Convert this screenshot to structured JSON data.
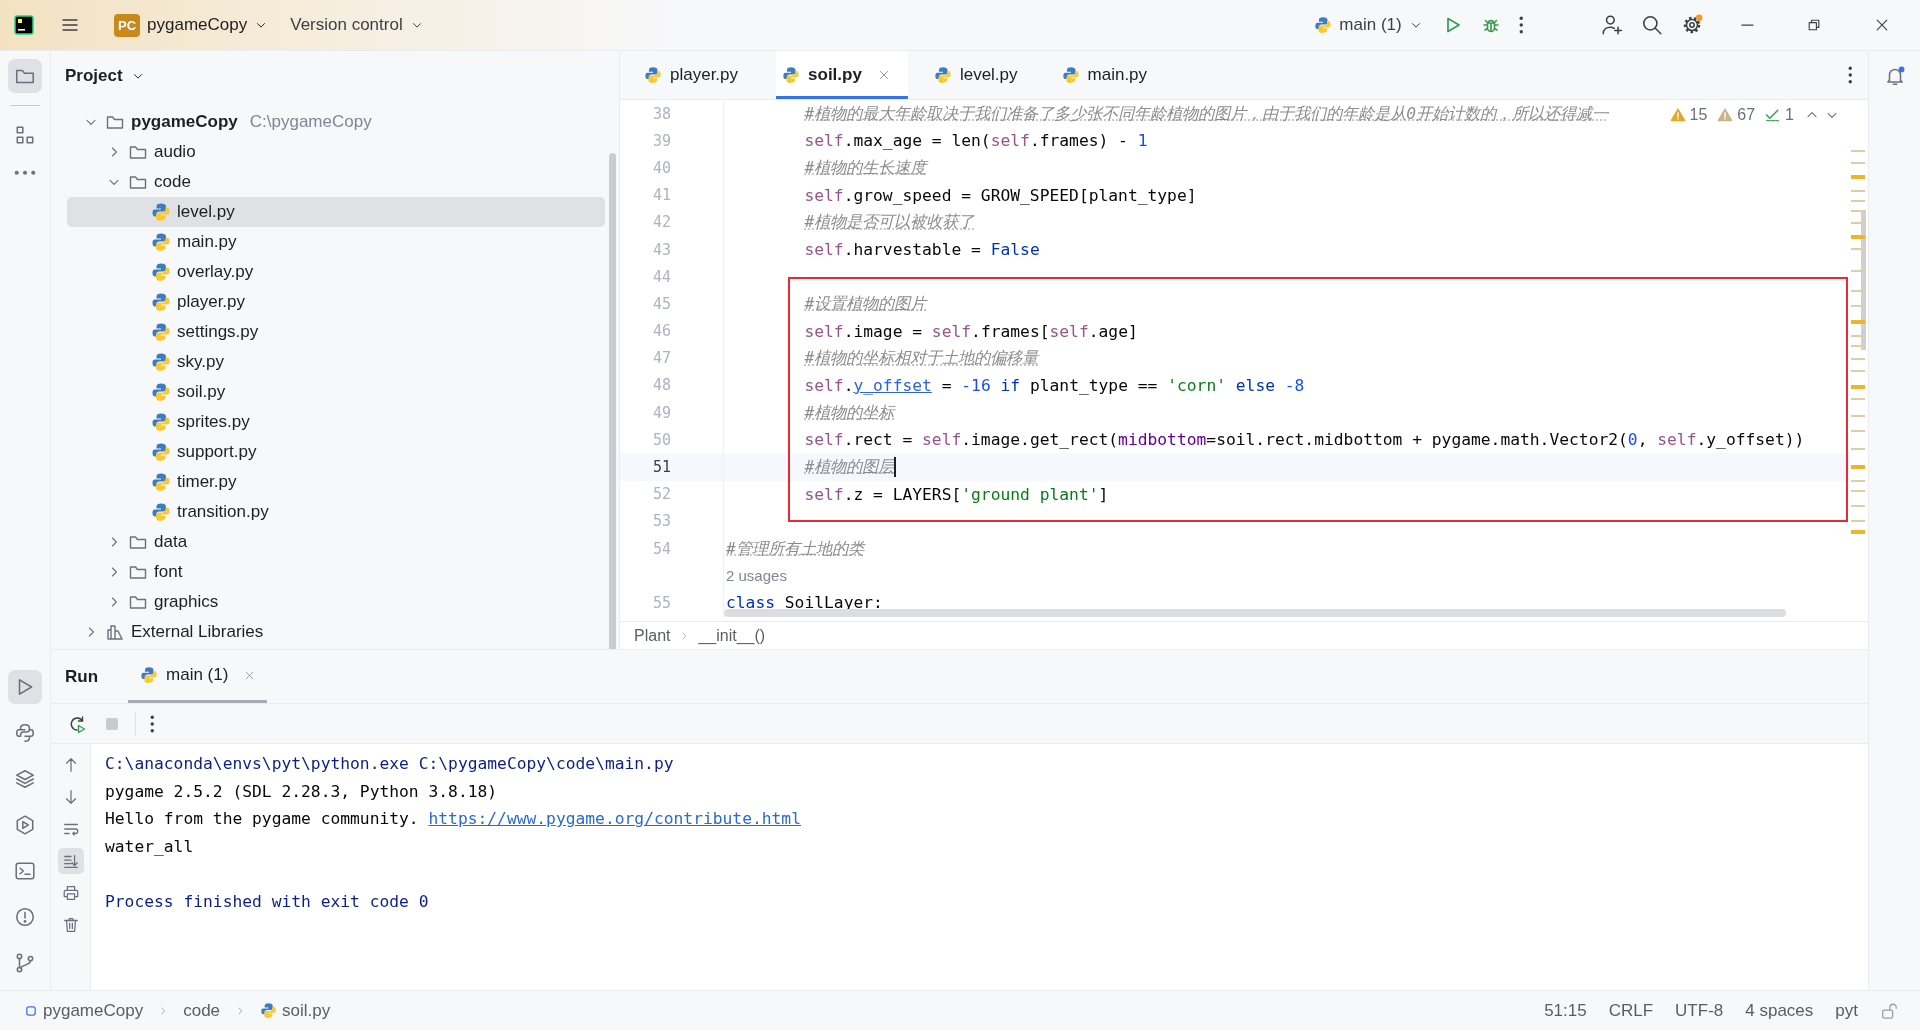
{
  "title_bar": {
    "project_badge": "PC",
    "project": "pygameCopy",
    "vcs": "Version control",
    "run_config": "main (1)"
  },
  "project_panel": {
    "title": "Project",
    "tree": [
      {
        "name": "pygameCopy",
        "path": "C:\\pygameCopy",
        "kind": "project",
        "expanded": true,
        "selected": false,
        "children": [
          {
            "name": "audio",
            "kind": "folder",
            "expanded": false,
            "selected": false
          },
          {
            "name": "code",
            "kind": "folder",
            "expanded": true,
            "selected": false,
            "children": [
              {
                "name": "level.py",
                "kind": "python",
                "selected": true
              },
              {
                "name": "main.py",
                "kind": "python",
                "selected": false
              },
              {
                "name": "overlay.py",
                "kind": "python",
                "selected": false
              },
              {
                "name": "player.py",
                "kind": "python",
                "selected": false
              },
              {
                "name": "settings.py",
                "kind": "python",
                "selected": false
              },
              {
                "name": "sky.py",
                "kind": "python",
                "selected": false
              },
              {
                "name": "soil.py",
                "kind": "python",
                "selected": false
              },
              {
                "name": "sprites.py",
                "kind": "python",
                "selected": false
              },
              {
                "name": "support.py",
                "kind": "python",
                "selected": false
              },
              {
                "name": "timer.py",
                "kind": "python",
                "selected": false
              },
              {
                "name": "transition.py",
                "kind": "python",
                "selected": false
              }
            ]
          },
          {
            "name": "data",
            "kind": "folder",
            "expanded": false,
            "selected": false
          },
          {
            "name": "font",
            "kind": "folder",
            "expanded": false,
            "selected": false
          },
          {
            "name": "graphics",
            "kind": "folder",
            "expanded": false,
            "selected": false
          }
        ]
      },
      {
        "name": "External Libraries",
        "kind": "library",
        "expanded": false,
        "selected": false
      }
    ]
  },
  "editor": {
    "tabs": [
      {
        "label": "player.py",
        "selected": false,
        "closable": false
      },
      {
        "label": "soil.py",
        "selected": true,
        "closable": true
      },
      {
        "label": "level.py",
        "selected": false,
        "closable": false
      },
      {
        "label": "main.py",
        "selected": false,
        "closable": false
      }
    ],
    "inspections": {
      "errors": "15",
      "warnings": "67",
      "weak_warnings": "1"
    },
    "code_blocks": [
      {
        "kind": "plain",
        "lines": [
          {
            "kind": "code",
            "number": "38",
            "current": false,
            "indented": true,
            "tokens": [
              {
                "kind": "comment",
                "text": "#植物的最大年龄取决于我们准备了多少张不同年龄植物的图片，由于我们的年龄是从0开始计数的，所以还得减一"
              }
            ]
          },
          {
            "kind": "code",
            "number": "39",
            "current": false,
            "indented": true,
            "tokens": [
              {
                "kind": "self",
                "text": "self"
              },
              {
                "kind": "text",
                "text": ".max_age = len("
              },
              {
                "kind": "self",
                "text": "self"
              },
              {
                "kind": "text",
                "text": ".frames) - "
              },
              {
                "kind": "number",
                "text": "1"
              }
            ]
          },
          {
            "kind": "code",
            "number": "40",
            "current": false,
            "indented": true,
            "tokens": [
              {
                "kind": "comment",
                "text": "#植物的生长速度"
              }
            ]
          },
          {
            "kind": "code",
            "number": "41",
            "current": false,
            "indented": true,
            "tokens": [
              {
                "kind": "self",
                "text": "self"
              },
              {
                "kind": "text",
                "text": ".grow_speed = GROW_SPEED[plant_type]"
              }
            ]
          },
          {
            "kind": "code",
            "number": "42",
            "current": false,
            "indented": true,
            "tokens": [
              {
                "kind": "comment",
                "text": "#植物是否可以被收获了"
              }
            ]
          },
          {
            "kind": "code",
            "number": "43",
            "current": false,
            "indented": true,
            "tokens": [
              {
                "kind": "self",
                "text": "self"
              },
              {
                "kind": "text",
                "text": ".harvestable = "
              },
              {
                "kind": "keyword",
                "text": "False"
              }
            ]
          },
          {
            "kind": "code",
            "number": "44",
            "current": false
          }
        ]
      },
      {
        "kind": "boxed",
        "lines": [
          {
            "kind": "code",
            "number": "45",
            "current": false,
            "indented": true,
            "tokens": [
              {
                "kind": "comment",
                "text": "#设置植物的图片"
              }
            ]
          },
          {
            "kind": "code",
            "number": "46",
            "current": false,
            "indented": true,
            "tokens": [
              {
                "kind": "self",
                "text": "self"
              },
              {
                "kind": "text",
                "text": ".image = "
              },
              {
                "kind": "self",
                "text": "self"
              },
              {
                "kind": "text",
                "text": ".frames["
              },
              {
                "kind": "self",
                "text": "self"
              },
              {
                "kind": "text",
                "text": ".age]"
              }
            ]
          },
          {
            "kind": "code",
            "number": "47",
            "current": false,
            "indented": true,
            "tokens": [
              {
                "kind": "comment",
                "text": "#植物的坐标相对于土地的偏移量"
              }
            ]
          },
          {
            "kind": "code",
            "number": "48",
            "current": false,
            "indented": true,
            "tokens": [
              {
                "kind": "self",
                "text": "self"
              },
              {
                "kind": "text",
                "text": "."
              },
              {
                "kind": "field",
                "text": "y_offset"
              },
              {
                "kind": "text",
                "text": " = "
              },
              {
                "kind": "number",
                "text": "-16"
              },
              {
                "kind": "keyword",
                "text": " if"
              },
              {
                "kind": "text",
                "text": " plant_type == "
              },
              {
                "kind": "string",
                "text": "'corn'"
              },
              {
                "kind": "keyword",
                "text": " else"
              },
              {
                "kind": "number",
                "text": " -8"
              }
            ]
          },
          {
            "kind": "code",
            "number": "49",
            "current": false,
            "indented": true,
            "tokens": [
              {
                "kind": "comment",
                "text": "#植物的坐标"
              }
            ]
          },
          {
            "kind": "code",
            "number": "50",
            "current": false,
            "indented": true,
            "tokens": [
              {
                "kind": "self",
                "text": "self"
              },
              {
                "kind": "text",
                "text": ".rect = "
              },
              {
                "kind": "self",
                "text": "self"
              },
              {
                "kind": "text",
                "text": ".image.get_rect("
              },
              {
                "kind": "param",
                "text": "midbottom"
              },
              {
                "kind": "text",
                "text": "=soil.rect.midbottom + pygame.math.Vector2("
              },
              {
                "kind": "number",
                "text": "0"
              },
              {
                "kind": "text",
                "text": ", "
              },
              {
                "kind": "self",
                "text": "self"
              },
              {
                "kind": "text",
                "text": ".y_offset))"
              }
            ]
          },
          {
            "kind": "code",
            "number": "51",
            "current": true,
            "indented": true,
            "tokens": [
              {
                "kind": "comment",
                "text": "#植物的图层"
              }
            ]
          },
          {
            "kind": "code",
            "number": "52",
            "current": false,
            "indented": true,
            "tokens": [
              {
                "kind": "self",
                "text": "self"
              },
              {
                "kind": "text",
                "text": ".z = LAYERS["
              },
              {
                "kind": "string",
                "text": "'ground plant'"
              },
              {
                "kind": "text",
                "text": "]"
              }
            ]
          }
        ]
      },
      {
        "kind": "plain",
        "lines": [
          {
            "kind": "code",
            "number": "53",
            "current": false
          },
          {
            "kind": "code",
            "number": "54",
            "current": false,
            "indented": false,
            "tokens": [
              {
                "kind": "comment",
                "text": "#管理所有土地的类"
              }
            ]
          },
          {
            "kind": "inlay",
            "text": "2 usages"
          },
          {
            "kind": "code",
            "number": "55",
            "current": false,
            "indented": false,
            "tokens": [
              {
                "kind": "keyword",
                "text": "class"
              },
              {
                "kind": "text",
                "text": " SoilLayer:"
              }
            ]
          }
        ]
      }
    ],
    "breadcrumbs": [
      "Plant",
      "__init__()"
    ]
  },
  "run_panel": {
    "title": "Run",
    "tabs": [
      {
        "label": "main (1)",
        "selected": true
      }
    ],
    "console": [
      {
        "kind": "command",
        "segments": [
          {
            "kind": "text",
            "text": "C:\\anaconda\\envs\\pyt\\python.exe C:\\pygameCopy\\code\\main.py"
          }
        ]
      },
      {
        "kind": "output",
        "segments": [
          {
            "kind": "text",
            "text": "pygame 2.5.2 (SDL 2.28.3, Python 3.8.18)"
          }
        ]
      },
      {
        "kind": "output",
        "segments": [
          {
            "kind": "text",
            "text": "Hello from the pygame community. "
          },
          {
            "kind": "link",
            "text": "https://www.pygame.org/contribute.html"
          }
        ]
      },
      {
        "kind": "output",
        "segments": [
          {
            "kind": "text",
            "text": "water_all"
          }
        ]
      },
      {
        "kind": "blank"
      },
      {
        "kind": "command",
        "segments": [
          {
            "kind": "text",
            "text": "Process finished with exit code 0"
          }
        ]
      }
    ]
  },
  "status_bar": {
    "path": [
      {
        "kind": "project",
        "text": "pygameCopy"
      },
      {
        "kind": "folder",
        "text": "code"
      },
      {
        "kind": "python",
        "text": "soil.py"
      }
    ],
    "position": "51:15",
    "line_separator": "CRLF",
    "encoding": "UTF-8",
    "indent": "4 spaces",
    "interpreter": "pyt"
  }
}
